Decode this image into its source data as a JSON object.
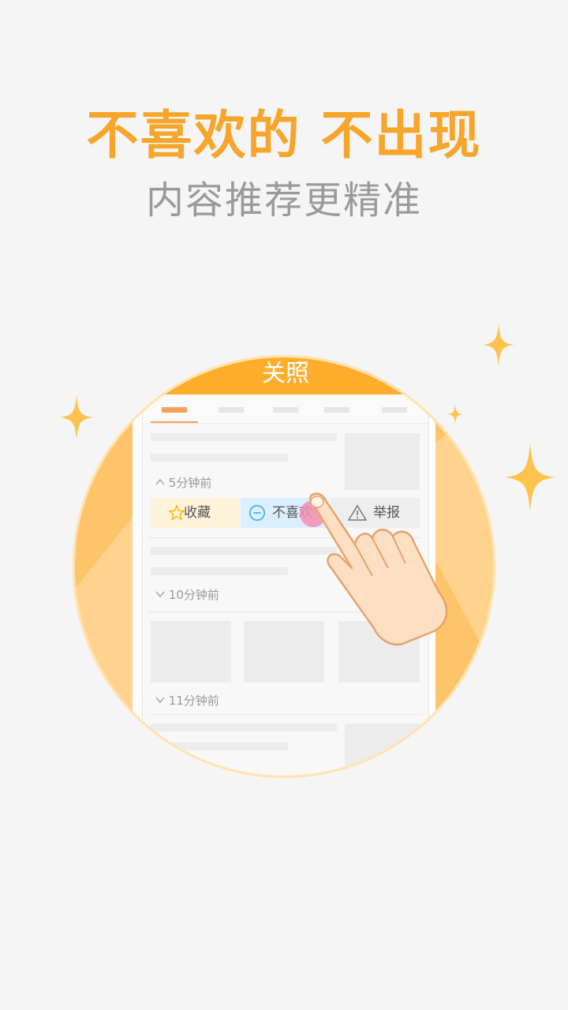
{
  "headline": "不喜欢的 不出现",
  "subline": "内容推荐更精准",
  "app": {
    "title": "关照",
    "actions": {
      "favorite": "收藏",
      "dislike": "不喜欢",
      "report": "举报"
    },
    "feed": [
      {
        "time": "5分钟前"
      },
      {
        "time": "10分钟前"
      },
      {
        "time": "11分钟前"
      }
    ]
  },
  "colors": {
    "accent": "#f7a52b",
    "appbar": "#ffad2d",
    "circle": "#fec46a",
    "subtitle": "#9a9a9a"
  },
  "icons": [
    "menu-icon",
    "star-icon",
    "minus-circle-icon",
    "warning-icon",
    "chevron-up-icon",
    "chevron-down-icon",
    "sparkle-icon",
    "hand-pointer-icon"
  ]
}
